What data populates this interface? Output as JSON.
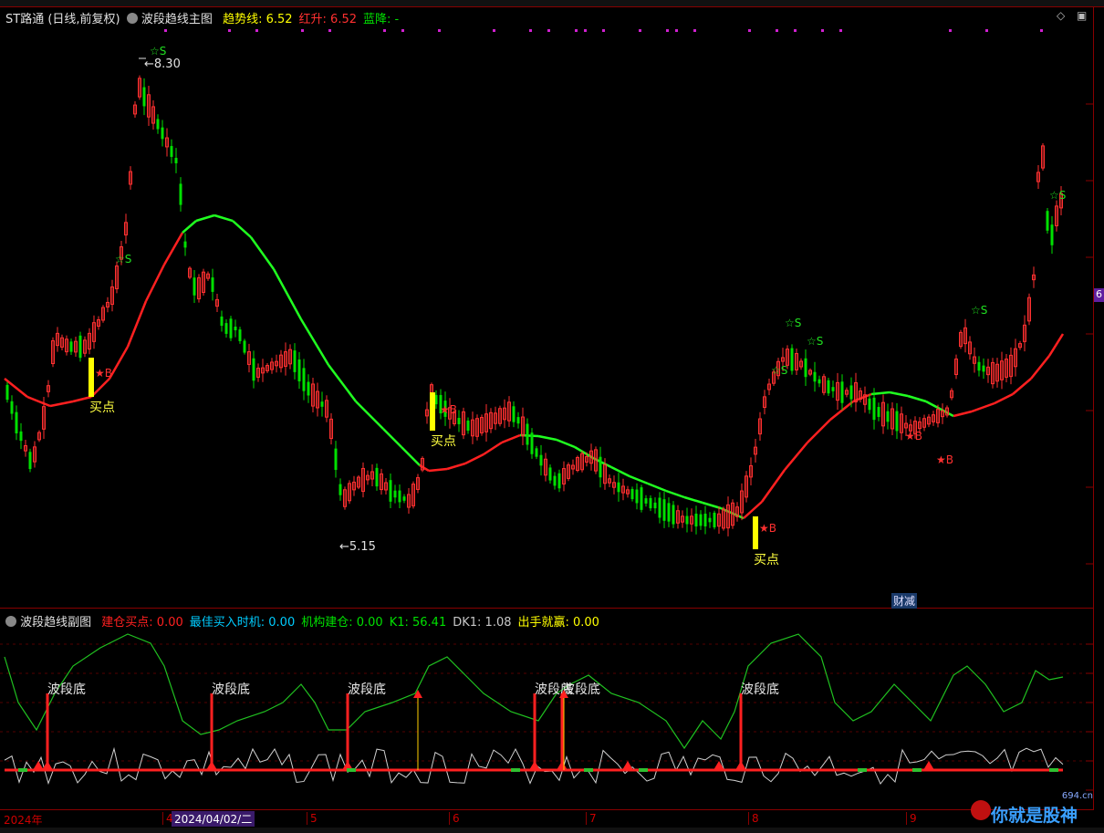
{
  "header": {
    "symbol": "ST路通",
    "period": "(日线,前复权)",
    "indicator": "波段趋线主图",
    "items": [
      {
        "label": "趋势线:",
        "value": "6.52",
        "color": "#ffff00"
      },
      {
        "label": "红升:",
        "value": "6.52",
        "color": "#ff3030"
      },
      {
        "label": "蓝降:",
        "value": "-",
        "color": "#00e000"
      }
    ]
  },
  "sub_header": {
    "indicator": "波段趋线副图",
    "items": [
      {
        "label": "建仓买点:",
        "value": "0.00",
        "color": "#ff2020"
      },
      {
        "label": "最佳买入时机:",
        "value": "0.00",
        "color": "#00ccff"
      },
      {
        "label": "机构建仓:",
        "value": "0.00",
        "color": "#00e000"
      },
      {
        "label": "K1:",
        "value": "56.41",
        "color": "#00e000"
      },
      {
        "label": "DK1:",
        "value": "1.08",
        "color": "#c8c8c8"
      },
      {
        "label": "出手就赢:",
        "value": "0.00",
        "color": "#ffff00"
      }
    ]
  },
  "labels": {
    "high_price": "8.30",
    "low_price": "5.15",
    "buy_point": "买点",
    "sell_mark": "☆S",
    "buy_mark": "★B",
    "wave_bottom": "波段底",
    "finance_badge": "财减",
    "right_tag": "6",
    "watermark": "你就是股神",
    "watermark_url": "694.cn"
  },
  "x_axis": {
    "year_label": "2024年",
    "cursor_date": "2024/04/02/二",
    "months": [
      "4",
      "5",
      "6",
      "7",
      "8",
      "9"
    ]
  },
  "colors": {
    "up": "#ff3030",
    "down": "#00e000",
    "trend_up": "#ff2020",
    "trend_down": "#20ff20",
    "buy_bar": "#ffff00"
  },
  "chart_data": [
    {
      "type": "candlestick",
      "title": "波段趋线主图",
      "high_marker": 8.3,
      "low_marker": 5.15,
      "last_value": 6.52,
      "buy_points": 4,
      "sell_marks": 8
    },
    {
      "type": "line",
      "title": "波段趋线副图",
      "series": [
        {
          "name": "K1",
          "last": 56.41
        },
        {
          "name": "DK1",
          "last": 1.08
        }
      ],
      "wave_bottom_count": 6
    }
  ]
}
